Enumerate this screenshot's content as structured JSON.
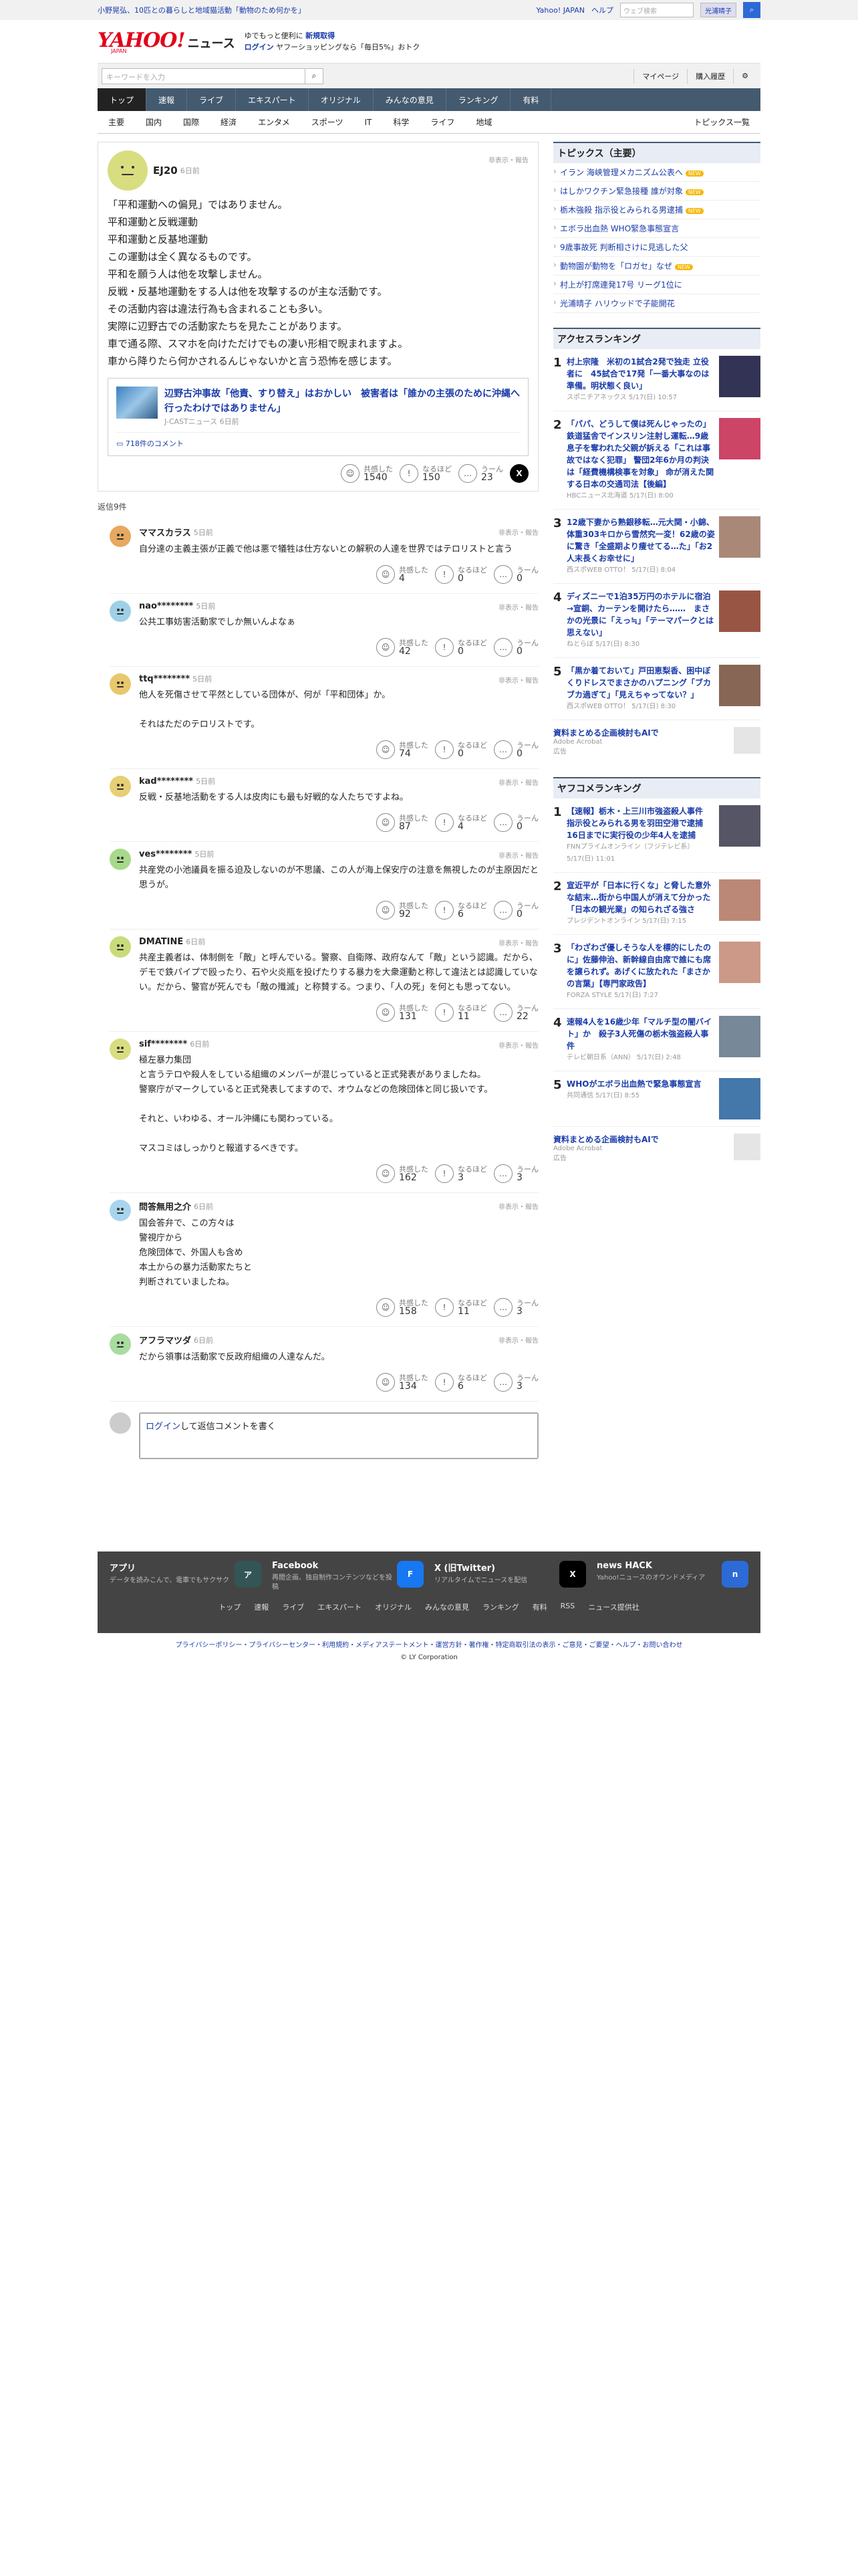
{
  "topbar": {
    "headline": "小野晃弘、10匹との暮らしと地域猫活動「動物のため何かを」",
    "links": [
      "Yahoo! JAPAN",
      "ヘルプ"
    ],
    "search_placeholder": "ウェブ検索",
    "user": "光浦晴子"
  },
  "masthead": {
    "logo": "YAHOO!",
    "logo_sub": "JAPAN",
    "site": "ニュース",
    "promo_line1": "ゆでもっと便利に",
    "promo_strong": "新規取得",
    "promo_line2a": "ログイン",
    "promo_line2b": "ヤフーショッピングなら「毎日5%」おトク"
  },
  "searchbar": {
    "placeholder": "キーワードを入力",
    "mypage": "マイページ",
    "history": "購入履歴"
  },
  "gnav": [
    "トップ",
    "速報",
    "ライブ",
    "エキスパート",
    "オリジナル",
    "みんなの意見",
    "ランキング",
    "有料"
  ],
  "snav": [
    "主要",
    "国内",
    "国際",
    "経済",
    "エンタメ",
    "スポーツ",
    "IT",
    "科学",
    "ライフ",
    "地域"
  ],
  "snav_end": "トピックス一覧",
  "post": {
    "user": "EJ20",
    "time": "6日前",
    "report": "非表示・報告",
    "text": "「平和運動への偏見」ではありません。\n平和運動と反戦運動\n平和運動と反基地運動\nこの運動は全く異なるものです。\n平和を願う人は他を攻撃しません。\n反戦・反基地運動をする人は他を攻撃するのが主な活動です。\nその活動内容は違法行為も含まれることも多い。\n実際に辺野古での活動家たちを見たことがあります。\n車で通る際、スマホを向けただけでもの凄い形相で睨まれますよ。\n車から降りたら何かされるんじゃないかと言う恐怖を感じます。",
    "article": {
      "title": "辺野古沖事故「他責、すり替え」はおかしい　被害者は「誰かの主張のために沖縄へ行ったわけではありません」",
      "source": "J-CASTニュース 6日前",
      "comments": "718件のコメント"
    },
    "reactions": {
      "a_label": "共感した",
      "a_count": "1540",
      "b_label": "なるほど",
      "b_count": "150",
      "c_label": "うーん",
      "c_count": "23"
    }
  },
  "reply_header": "返信9件",
  "replies": [
    {
      "user": "ママスカラス",
      "time": "5日前",
      "text": "自分達の主義主張が正義で他は悪で犠牲は仕方ないとの解釈の人達を世界ではテロリストと言う",
      "a": "4",
      "b": "0",
      "c": "0"
    },
    {
      "user": "nao********",
      "time": "5日前",
      "text": "公共工事妨害活動家でしか無いんよなぁ",
      "a": "42",
      "b": "0",
      "c": "0"
    },
    {
      "user": "ttq********",
      "time": "5日前",
      "text": "他人を死傷させて平然としている団体が、何が「平和団体」か。\n\nそれはただのテロリストです。",
      "a": "74",
      "b": "0",
      "c": "0"
    },
    {
      "user": "kad********",
      "time": "5日前",
      "text": "反戦・反基地活動をする人は皮肉にも最も好戦的な人たちですよね。",
      "a": "87",
      "b": "4",
      "c": "0"
    },
    {
      "user": "ves********",
      "time": "5日前",
      "text": "共産党の小池議員を振る迫及しないのが不思議、この人が海上保安庁の注意を無視したのが主原因だと思うが。",
      "a": "92",
      "b": "6",
      "c": "0"
    },
    {
      "user": "DMATINE",
      "time": "6日前",
      "text": "共産主義者は、体制側を「敵」と呼んでいる。警察、自衛隊、政府なんて「敵」という認識。だから、デモで鉄パイプで殴ったり、石や火炎瓶を投げたりする暴力を大衆運動と称して違法とは認識していない。だから、警官が死んでも「敵の殲滅」と称賛する。つまり、「人の死」を何とも思ってない。",
      "a": "131",
      "b": "11",
      "c": "22"
    },
    {
      "user": "sif********",
      "time": "6日前",
      "text": "極左暴力集団\nと言うテロや殺人をしている組織のメンバーが混じっていると正式発表がありましたね。\n警察庁がマークしていると正式発表してますので、オウムなどの危険団体と同じ扱いです。\n\nそれと、いわゆる、オール沖縄にも関わっている。\n\nマスコミはしっかりと報道するべきです。",
      "a": "162",
      "b": "3",
      "c": "3"
    },
    {
      "user": "問答無用之介",
      "time": "6日前",
      "text": "国会答弁で、この方々は\n警視庁から\n危険団体で、外国人も含め\n本土からの暴力活動家たちと\n判断されていましたね。",
      "a": "158",
      "b": "11",
      "c": "3"
    },
    {
      "user": "アフラマツダ",
      "time": "6日前",
      "text": "だから領事は活動家で反政府組織の人達なんだ。",
      "a": "134",
      "b": "6",
      "c": "3"
    }
  ],
  "reply_input": {
    "login": "ログイン",
    "text": "して返信コメントを書く"
  },
  "side": {
    "topics_title": "トピックス（主要）",
    "topics": [
      {
        "t": "イラン 海峡管理メカニズム公表へ",
        "n": true
      },
      {
        "t": "はしかワクチン緊急接種 誰が対象",
        "n": true
      },
      {
        "t": "栃木強殺 指示役とみられる男逮捕",
        "n": true
      },
      {
        "t": "エボラ出血熱 WHO緊急事態宣言",
        "n": false
      },
      {
        "t": "9歳事故死 判断相さけに見逃した父",
        "n": false
      },
      {
        "t": "動物園が動物を「ロガセ」なぜ",
        "n": true
      },
      {
        "t": "村上が打席連発17号 リーグ1位に",
        "n": false
      },
      {
        "t": "光浦晴子 ハリウッドで子能開花",
        "n": false
      }
    ],
    "access_title": "アクセスランキング",
    "access": [
      {
        "n": "1",
        "t": "村上宗隆　米初の1試合2発で独走 立役者に　45試合で17発「一番大事なのは準備。明状態く良い」",
        "m": "スポニチアネックス 5/17(日) 10:57",
        "c": "#335"
      },
      {
        "n": "2",
        "t": "「パパ、どうして僕は死んじゃったの」鉄道猛舎でインスリン注射し運転…9歳息子を奪われた父親が訴える「これは事故ではなく犯罪」 警団2年6か月の判決は「経費機構検事を対象」 命が消えた関する日本の交通司法【後編】",
        "m": "HBCニュース北海道 5/17(日) 8:00",
        "c": "#c46"
      },
      {
        "n": "3",
        "t": "12歳下妻から熟銀移転…元大関・小錦、体重303キロから雪然究一変！62歳の姿に驚き「全盛期より痩せてる…た」「お2人末長くお幸せに」",
        "m": "西スポWEB OTTO！ 5/17(日) 8:04",
        "c": "#a87"
      },
      {
        "n": "4",
        "t": "ディズニーで1泊35万円のホテルに宿泊→宣銅、カーテンを開けたら……　まさかの光景に「えっ≒」「テーマパークとは思えない」",
        "m": "ねとらぼ 5/17(日) 8:30",
        "c": "#954"
      },
      {
        "n": "5",
        "t": "「黒か着ておいて」戸田恵梨香、困中ぼくりドレスでまさかのハプニング「ブカブカ過ぎて」「見えちゃってない？」",
        "m": "西スポWEB OTTO！ 5/17(日) 8:30",
        "c": "#865"
      }
    ],
    "pr1": {
      "t": "資料まとめる企画検討もAIで",
      "m": "Adobe Acrobat",
      "badge": "広告"
    },
    "yafuko_title": "ヤフコメランキング",
    "yafuko": [
      {
        "n": "1",
        "t": "【速報】栃木・上三川市強盗殺人事件　指示役とみられる男を羽田空港で逮捕　16日までに実行役の少年4人を逮捕",
        "m": "FNNプライムオンライン（フジテレビ系） 5/17(日) 11:01",
        "c": "#556"
      },
      {
        "n": "2",
        "t": "宣近平が「日本に行くな」と脅した意外な結末…街から中国人が消えて分かった「日本の観光業」の知られざる強さ",
        "m": "プレジデントオンライン 5/17(日) 7:15",
        "c": "#b87"
      },
      {
        "n": "3",
        "t": "「わざわざ優しそうな人を標的にしたのに」佐藤伸治、新幹線自由席で誰にも席を譲られず。あげくに放たれた「まさかの言葉」【専門家政告】",
        "m": "FORZA STYLE 5/17(日) 7:27",
        "c": "#c98"
      },
      {
        "n": "4",
        "t": "速報4人を16歳少年「マルチ型の闇バイト」か　殺子3人死傷の栃木強盗殺人事件",
        "m": "テレビ朝日系（ANN） 5/17(日) 2:48",
        "c": "#789"
      },
      {
        "n": "5",
        "t": "WHOがエボラ出血熱で緊急事態宣言",
        "m": "共同通信 5/17(日) 8:55",
        "c": "#47a"
      }
    ],
    "pr2": {
      "t": "資料まとめる企画検討もAIで",
      "m": "Adobe Acrobat",
      "badge": "広告"
    }
  },
  "footer": {
    "apps": [
      {
        "t": "アプリ",
        "d": "データを読みこんで、電車でもサクサク",
        "c": "#355"
      },
      {
        "t": "Facebook",
        "d": "再閲企画、独自制作コンテンツなどを投稿",
        "c": "#1877f2"
      },
      {
        "t": "X (旧Twitter)",
        "d": "リアルタイムでニュースを配信",
        "c": "#000"
      },
      {
        "t": "news HACK",
        "d": "Yahoo!ニュースのオウンドメディア",
        "c": "#2c6bd6"
      }
    ],
    "links": [
      "トップ",
      "速報",
      "ライブ",
      "エキスパート",
      "オリジナル",
      "みんなの意見",
      "ランキング",
      "有料",
      "RSS",
      "ニュース提供社"
    ],
    "legal": "プライバシーポリシー・プライバシーセンター・利用規約・メディアステートメント・運営方針・著作権・特定商取引法の表示・ご意見・ご要望・ヘルプ・お問い合わせ",
    "copyright": "© LY Corporation"
  }
}
